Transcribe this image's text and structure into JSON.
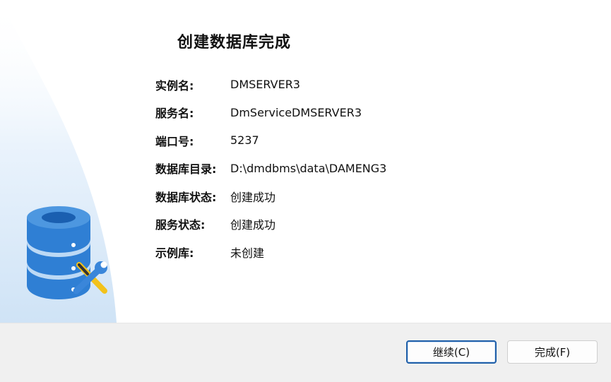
{
  "dialog": {
    "title": "创建数据库完成"
  },
  "info": [
    {
      "label": "实例名:",
      "value": "DMSERVER3"
    },
    {
      "label": "服务名:",
      "value": "DmServiceDMSERVER3"
    },
    {
      "label": "端口号:",
      "value": "5237"
    },
    {
      "label": "数据库目录:",
      "value": "D:\\dmdbms\\data\\DAMENG3"
    },
    {
      "label": "数据库状态:",
      "value": "创建成功"
    },
    {
      "label": "服务状态:",
      "value": "创建成功"
    },
    {
      "label": "示例库:",
      "value": "未创建"
    }
  ],
  "buttons": {
    "continue_label": "继续(C)",
    "finish_label": "完成(F)"
  },
  "icons": {
    "illustration": "database-wrench-icon"
  },
  "colors": {
    "accent": "#1f5fa8",
    "db_blue": "#2f7fd4",
    "tool_yellow": "#f2c21b"
  }
}
